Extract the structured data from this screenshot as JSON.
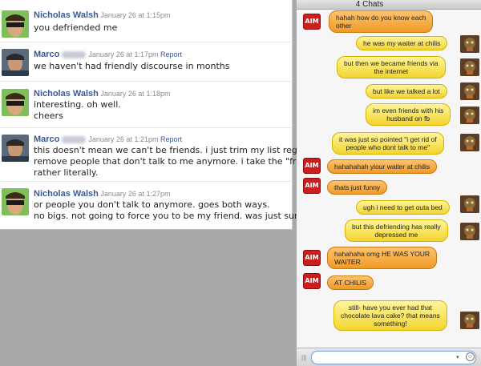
{
  "facebook": {
    "messages": [
      {
        "author": "Nicholas Walsh",
        "timestamp": "January 26 at 1:15pm",
        "report": "",
        "avatar": "nicholas-avatar",
        "lines": [
          "you defriended me"
        ]
      },
      {
        "author": "Marco",
        "timestamp": "January 26 at 1:17pm",
        "report": "Report",
        "avatar": "marco-avatar",
        "lines": [
          "we haven't had friendly discourse in months"
        ]
      },
      {
        "author": "Nicholas Walsh",
        "timestamp": "January 26 at 1:18pm",
        "report": "",
        "avatar": "nicholas-avatar",
        "lines": [
          "interesting. oh well.",
          "cheers"
        ]
      },
      {
        "author": "Marco",
        "timestamp": "January 26 at 1:21pm",
        "report": "Report",
        "avatar": "marco-avatar",
        "lines": [
          "this doesn't mean we can't be friends. i just trim my list regularly and",
          "remove people that don't talk to me anymore. i take the \"friends\" part",
          "rather literally."
        ]
      },
      {
        "author": "Nicholas Walsh",
        "timestamp": "January 26 at 1:27pm",
        "report": "",
        "avatar": "nicholas-avatar",
        "lines": [
          "or people you don't talk to anymore. goes both ways.",
          "no bigs. not going to force you to be my friend. was just surprised."
        ]
      }
    ]
  },
  "chat": {
    "header": "4 Chats",
    "aim_label": "AIM",
    "messages": [
      {
        "dir": "in",
        "lines": [
          "hahah how do you know each",
          "other"
        ]
      },
      {
        "dir": "out",
        "lines": [
          "he was my waiter at chilis"
        ]
      },
      {
        "dir": "out",
        "lines": [
          "but then we became friends via",
          "the internet"
        ]
      },
      {
        "dir": "out",
        "lines": [
          "but like we talked a lot"
        ]
      },
      {
        "dir": "out",
        "lines": [
          "im even friends with his",
          "husband  on fb"
        ]
      },
      {
        "dir": "out",
        "lines": [
          "it was just so pointed \"i get rid of",
          "people who dont talk to me\""
        ]
      },
      {
        "dir": "in",
        "lines": [
          "hahahahah yiour waiter at chilis"
        ]
      },
      {
        "dir": "in",
        "lines": [
          "thats just funny"
        ]
      },
      {
        "dir": "out",
        "lines": [
          "ugh i need to get outa bed"
        ]
      },
      {
        "dir": "out",
        "lines": [
          "but this defriending has really",
          "depressed me"
        ]
      },
      {
        "dir": "in",
        "lines": [
          "hahahaha omg HE WAS YOUR",
          "WAITER"
        ]
      },
      {
        "dir": "in",
        "lines": [
          "AT CHILIS"
        ]
      },
      {
        "dir": "out",
        "lines": [
          "still- have you ever had that",
          "chocolate lava cake? that means",
          "something!"
        ]
      }
    ],
    "input": {
      "value": "",
      "placeholder": ""
    },
    "icons": {
      "grip": "resize-grip-icon",
      "dropdown": "dropdown-icon",
      "smiley": "smiley-icon"
    }
  },
  "colors": {
    "facebook_link": "#3b5998",
    "outgoing_bubble": "#f3d430",
    "incoming_bubble": "#ef9a27",
    "aim_red": "#cc1e1e"
  }
}
